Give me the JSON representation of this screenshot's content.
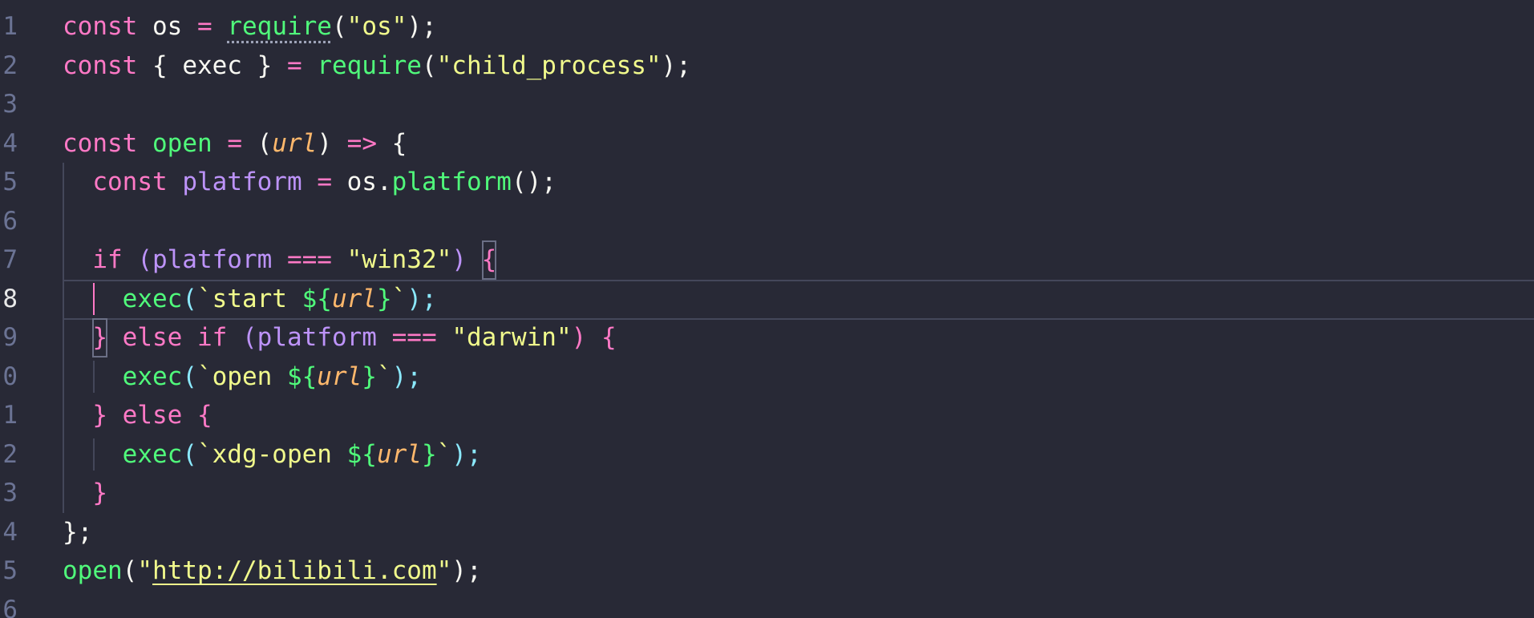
{
  "editor": {
    "language": "javascript",
    "theme": {
      "background": "#282936",
      "keyword": "#ff79c6",
      "function": "#50fa7b",
      "string": "#f1fa8c",
      "variable_purple": "#bd93f9",
      "parameter": "#ffb86c",
      "line_number": "#6b7394"
    },
    "active_line": 8,
    "line_numbers": [
      "1",
      "2",
      "3",
      "4",
      "5",
      "6",
      "7",
      "8",
      "9",
      "0",
      "1",
      "2",
      "3",
      "4",
      "5",
      "6"
    ],
    "lines": [
      {
        "tokens": [
          {
            "t": "const",
            "c": "k"
          },
          {
            "t": " os ",
            "c": "v"
          },
          {
            "t": "=",
            "c": "op"
          },
          {
            "t": " ",
            "c": "p"
          },
          {
            "t": "require",
            "c": "f",
            "sq": true
          },
          {
            "t": "(",
            "c": "p"
          },
          {
            "t": "\"os\"",
            "c": "s"
          },
          {
            "t": ");",
            "c": "p"
          }
        ]
      },
      {
        "tokens": [
          {
            "t": "const",
            "c": "k"
          },
          {
            "t": " { exec } ",
            "c": "v"
          },
          {
            "t": "=",
            "c": "op"
          },
          {
            "t": " ",
            "c": "p"
          },
          {
            "t": "require",
            "c": "f"
          },
          {
            "t": "(",
            "c": "p"
          },
          {
            "t": "\"child_process\"",
            "c": "s"
          },
          {
            "t": ");",
            "c": "p"
          }
        ]
      },
      {
        "tokens": []
      },
      {
        "tokens": [
          {
            "t": "const",
            "c": "k"
          },
          {
            "t": " ",
            "c": "p"
          },
          {
            "t": "open",
            "c": "f"
          },
          {
            "t": " ",
            "c": "p"
          },
          {
            "t": "=",
            "c": "op"
          },
          {
            "t": " (",
            "c": "p"
          },
          {
            "t": "url",
            "c": "pr"
          },
          {
            "t": ") ",
            "c": "p"
          },
          {
            "t": "=>",
            "c": "op"
          },
          {
            "t": " {",
            "c": "p"
          }
        ]
      },
      {
        "tokens": [
          {
            "t": "  ",
            "c": "p"
          },
          {
            "t": "const",
            "c": "k"
          },
          {
            "t": " ",
            "c": "p"
          },
          {
            "t": "platform",
            "c": "vp"
          },
          {
            "t": " ",
            "c": "p"
          },
          {
            "t": "=",
            "c": "op"
          },
          {
            "t": " os.",
            "c": "v"
          },
          {
            "t": "platform",
            "c": "f"
          },
          {
            "t": "();",
            "c": "p"
          }
        ]
      },
      {
        "tokens": []
      },
      {
        "tokens": [
          {
            "t": "  ",
            "c": "p"
          },
          {
            "t": "if",
            "c": "k"
          },
          {
            "t": " (",
            "c": "vp"
          },
          {
            "t": "platform",
            "c": "vp"
          },
          {
            "t": " ",
            "c": "p"
          },
          {
            "t": "===",
            "c": "op"
          },
          {
            "t": " ",
            "c": "p"
          },
          {
            "t": "\"win32\"",
            "c": "s"
          },
          {
            "t": ") ",
            "c": "vp"
          },
          {
            "t": "{",
            "c": "pk",
            "bm": true
          }
        ]
      },
      {
        "tokens": [
          {
            "t": "    ",
            "c": "p"
          },
          {
            "t": "exec",
            "c": "f"
          },
          {
            "t": "(",
            "c": "tb"
          },
          {
            "t": "`start ",
            "c": "s"
          },
          {
            "t": "${",
            "c": "f"
          },
          {
            "t": "url",
            "c": "pr"
          },
          {
            "t": "}",
            "c": "f"
          },
          {
            "t": "`",
            "c": "s"
          },
          {
            "t": ");",
            "c": "tb"
          }
        ]
      },
      {
        "tokens": [
          {
            "t": "  ",
            "c": "p"
          },
          {
            "t": "}",
            "c": "pk",
            "bm": true
          },
          {
            "t": " ",
            "c": "p"
          },
          {
            "t": "else",
            "c": "k"
          },
          {
            "t": " ",
            "c": "p"
          },
          {
            "t": "if",
            "c": "k"
          },
          {
            "t": " (",
            "c": "vp"
          },
          {
            "t": "platform",
            "c": "vp"
          },
          {
            "t": " ",
            "c": "p"
          },
          {
            "t": "===",
            "c": "op"
          },
          {
            "t": " ",
            "c": "p"
          },
          {
            "t": "\"darwin\"",
            "c": "s"
          },
          {
            "t": ") {",
            "c": "pk"
          }
        ]
      },
      {
        "tokens": [
          {
            "t": "    ",
            "c": "p"
          },
          {
            "t": "exec",
            "c": "f"
          },
          {
            "t": "(",
            "c": "tb"
          },
          {
            "t": "`open ",
            "c": "s"
          },
          {
            "t": "${",
            "c": "f"
          },
          {
            "t": "url",
            "c": "pr"
          },
          {
            "t": "}",
            "c": "f"
          },
          {
            "t": "`",
            "c": "s"
          },
          {
            "t": ");",
            "c": "tb"
          }
        ]
      },
      {
        "tokens": [
          {
            "t": "  ",
            "c": "p"
          },
          {
            "t": "}",
            "c": "pk"
          },
          {
            "t": " ",
            "c": "p"
          },
          {
            "t": "else",
            "c": "k"
          },
          {
            "t": " ",
            "c": "p"
          },
          {
            "t": "{",
            "c": "pk"
          }
        ]
      },
      {
        "tokens": [
          {
            "t": "    ",
            "c": "p"
          },
          {
            "t": "exec",
            "c": "f"
          },
          {
            "t": "(",
            "c": "tb"
          },
          {
            "t": "`xdg-open ",
            "c": "s"
          },
          {
            "t": "${",
            "c": "f"
          },
          {
            "t": "url",
            "c": "pr"
          },
          {
            "t": "}",
            "c": "f"
          },
          {
            "t": "`",
            "c": "s"
          },
          {
            "t": ");",
            "c": "tb"
          }
        ]
      },
      {
        "tokens": [
          {
            "t": "  ",
            "c": "p"
          },
          {
            "t": "}",
            "c": "pk"
          }
        ]
      },
      {
        "tokens": [
          {
            "t": "};",
            "c": "p"
          }
        ]
      },
      {
        "tokens": [
          {
            "t": "open",
            "c": "f"
          },
          {
            "t": "(",
            "c": "p"
          },
          {
            "t": "\"",
            "c": "s"
          },
          {
            "t": "http://bilibili.com",
            "c": "s",
            "link": true
          },
          {
            "t": "\"",
            "c": "s"
          },
          {
            "t": ");",
            "c": "p"
          }
        ]
      },
      {
        "tokens": []
      }
    ]
  }
}
